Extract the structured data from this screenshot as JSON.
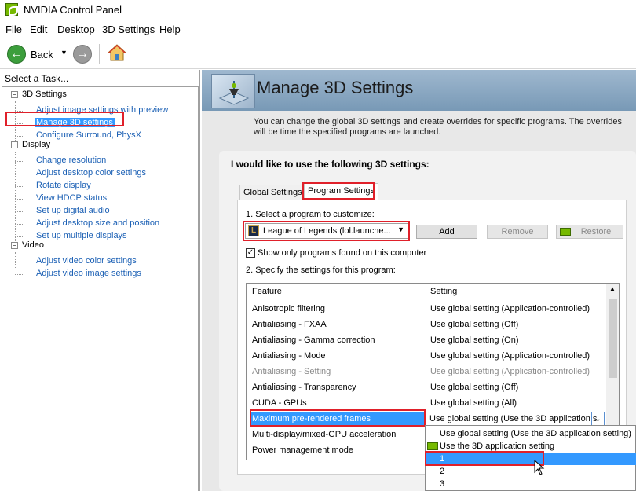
{
  "window": {
    "title": "NVIDIA Control Panel",
    "app_icon": "nvidia-icon"
  },
  "menu": [
    "File",
    "Edit",
    "Desktop",
    "3D Settings",
    "Help"
  ],
  "toolbar": {
    "back_label": "Back",
    "icons": [
      "back-arrow-icon",
      "forward-arrow-icon",
      "home-icon"
    ]
  },
  "task_pane": {
    "header": "Select a Task...",
    "groups": [
      {
        "label": "3D Settings",
        "items": [
          "Adjust image settings with preview",
          "Manage 3D settings",
          "Configure Surround, PhysX"
        ]
      },
      {
        "label": "Display",
        "items": [
          "Change resolution",
          "Adjust desktop color settings",
          "Rotate display",
          "View HDCP status",
          "Set up digital audio",
          "Adjust desktop size and position",
          "Set up multiple displays"
        ]
      },
      {
        "label": "Video",
        "items": [
          "Adjust video color settings",
          "Adjust video image settings"
        ]
      }
    ],
    "selected_item": "Manage 3D settings"
  },
  "page": {
    "title": "Manage 3D Settings",
    "description": "You can change the global 3D settings and create overrides for specific programs. The overrides will be time the specified programs are launched.",
    "group_title": "I would like to use the following 3D settings:",
    "tabs": [
      "Global Settings",
      "Program Settings"
    ],
    "active_tab": "Program Settings",
    "step1_label": "1. Select a program to customize:",
    "program_selected": "League of Legends (lol.launche...",
    "buttons": {
      "add": "Add",
      "remove": "Remove",
      "restore": "Restore"
    },
    "checkbox_label": "Show only programs found on this computer",
    "checkbox_checked": true,
    "step2_label": "2. Specify the settings for this program:",
    "grid": {
      "headers": {
        "feature": "Feature",
        "setting": "Setting"
      },
      "rows": [
        {
          "feature": "Anisotropic filtering",
          "setting": "Use global setting (Application-controlled)"
        },
        {
          "feature": "Antialiasing - FXAA",
          "setting": "Use global setting (Off)"
        },
        {
          "feature": "Antialiasing - Gamma correction",
          "setting": "Use global setting (On)"
        },
        {
          "feature": "Antialiasing - Mode",
          "setting": "Use global setting (Application-controlled)"
        },
        {
          "feature": "Antialiasing - Setting",
          "setting": "Use global setting (Application-controlled)"
        },
        {
          "feature": "Antialiasing - Transparency",
          "setting": "Use global setting (Off)"
        },
        {
          "feature": "CUDA - GPUs",
          "setting": "Use global setting (All)"
        },
        {
          "feature": "Maximum pre-rendered frames",
          "setting": "Use global setting (Use the 3D application s"
        },
        {
          "feature": "Multi-display/mixed-GPU acceleration",
          "setting": ""
        },
        {
          "feature": "Power management mode",
          "setting": ""
        }
      ]
    },
    "dropdown_options": [
      "Use global setting (Use the 3D application setting)",
      "Use the 3D application setting",
      "1",
      "2",
      "3"
    ],
    "dropdown_highlighted": "1"
  },
  "colors": {
    "highlight": "#3399ff",
    "annotation_red": "#e0202a",
    "nvidia_green": "#76b900"
  }
}
